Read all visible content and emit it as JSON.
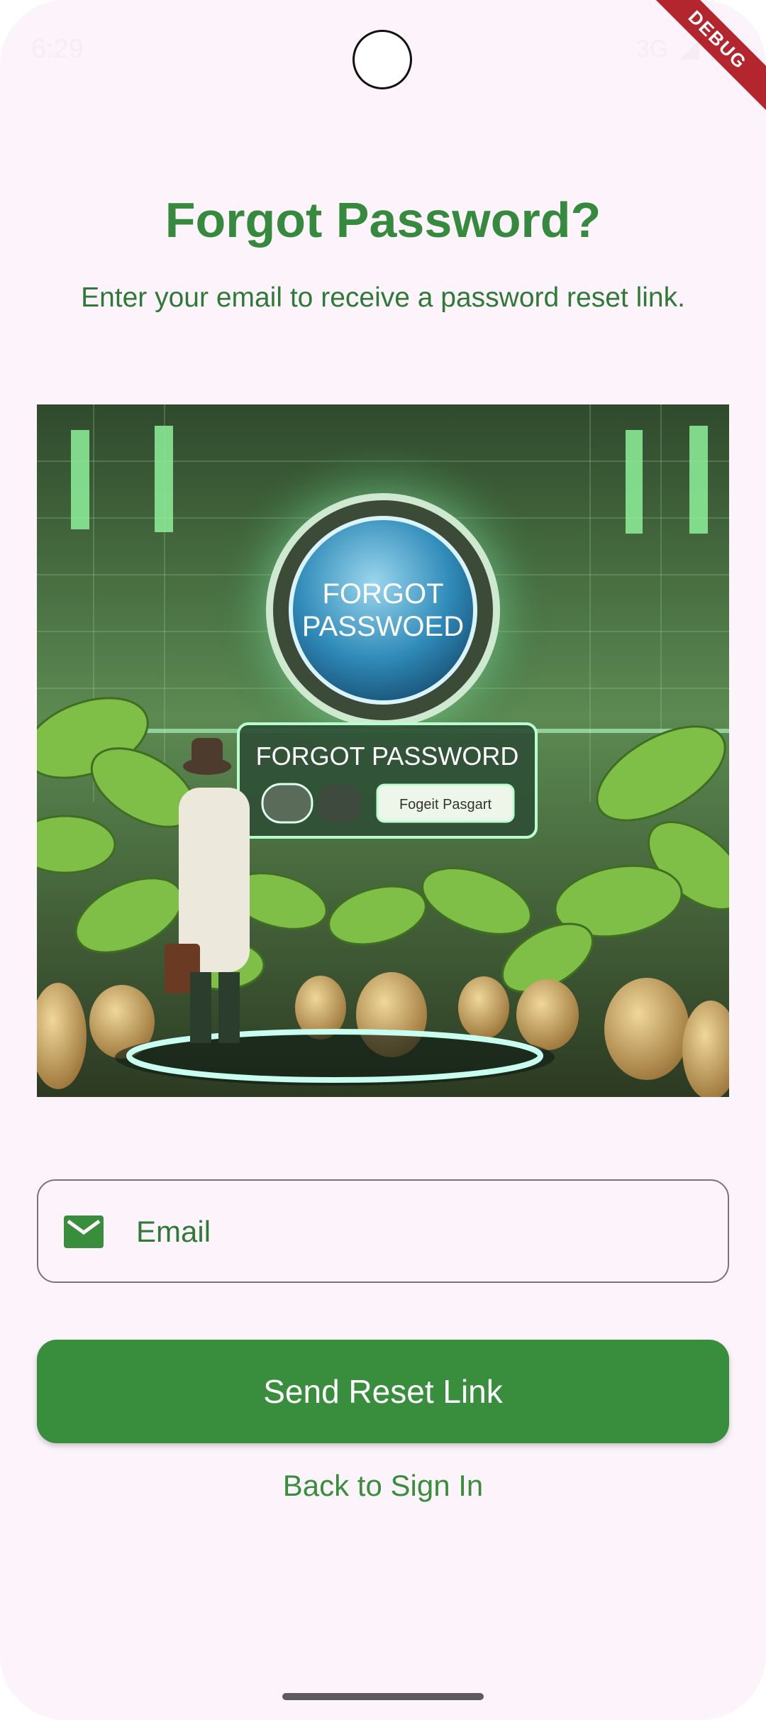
{
  "status_bar": {
    "time": "6:29",
    "network": "3G"
  },
  "debug_banner": "DEBUG",
  "title": "Forgot Password?",
  "subtitle": "Enter your email to receive a password reset link.",
  "hero_image": {
    "button_text_line1": "FORGOT",
    "button_text_line2": "PASSWOED",
    "panel_title": "FORGOT PASSWORD",
    "panel_field_text": "Fogeit Pasgart"
  },
  "email_field": {
    "placeholder": "Email",
    "value": ""
  },
  "send_button_label": "Send Reset Link",
  "back_link_label": "Back to Sign In",
  "colors": {
    "primary": "#388e3c",
    "title": "#358a3e",
    "background": "#fdf3fb",
    "debug_banner": "#b3262e"
  }
}
